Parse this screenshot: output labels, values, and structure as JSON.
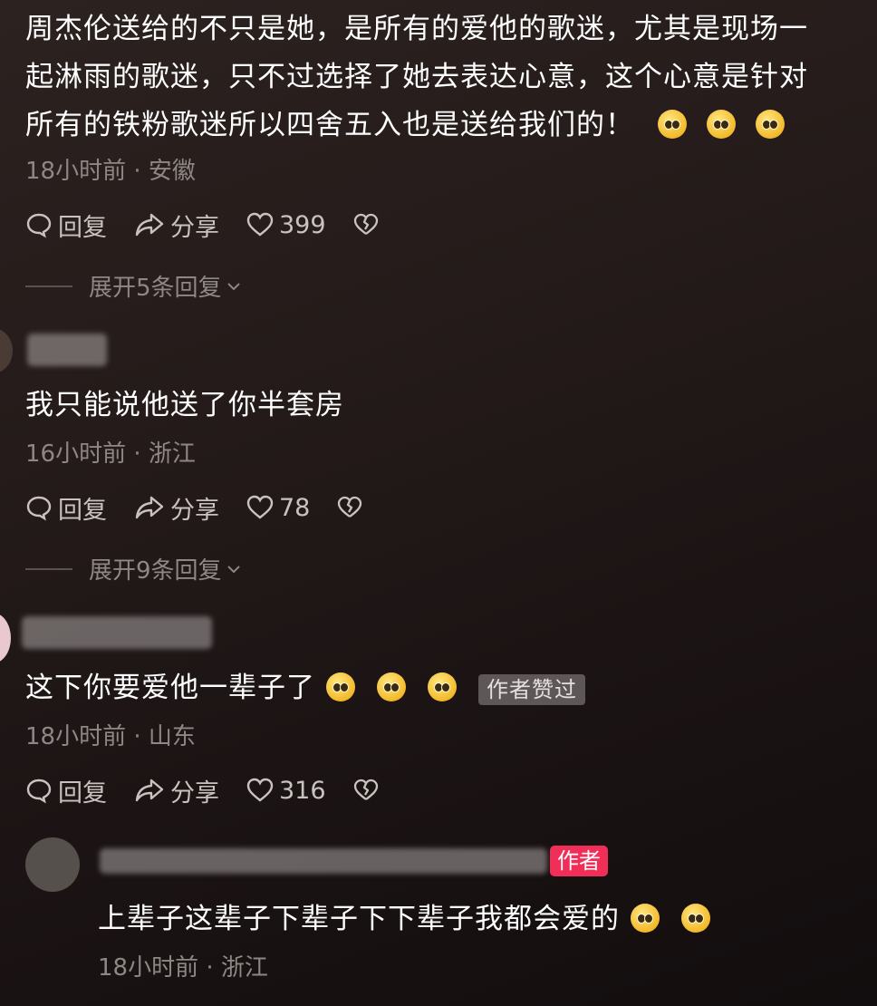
{
  "comments": [
    {
      "text_lines": [
        "周杰伦送给的不只是她，是所有的爱他的歌迷，尤其是现场一",
        "起淋雨的歌迷，只不过选择了她去表达心意，这个心意是针对",
        "所有的铁粉歌迷所以四舍五入也是送给我们的！"
      ],
      "emoji": [
        "pleading-face-emoji",
        "pleading-face-emoji",
        "pleading-face-emoji"
      ],
      "time": "18小时前 · 安徽",
      "reply_label": "回复",
      "share_label": "分享",
      "likes": "399",
      "expand_label": "展开5条回复"
    },
    {
      "text": "我只能说他送了你半套房",
      "time": "16小时前 · 浙江",
      "reply_label": "回复",
      "share_label": "分享",
      "likes": "78",
      "expand_label": "展开9条回复"
    },
    {
      "text": "这下你要爱他一辈子了",
      "emoji": [
        "holding-back-tears-emoji",
        "holding-back-tears-emoji",
        "holding-back-tears-emoji"
      ],
      "badge": "作者赞过",
      "time": "18小时前 · 山东",
      "reply_label": "回复",
      "share_label": "分享",
      "likes": "316"
    }
  ],
  "reply": {
    "author_badge": "作者",
    "text": "上辈子这辈子下辈子下下辈子我都会爱的",
    "emoji": [
      "loudly-crying-face-emoji",
      "loudly-crying-face-emoji"
    ],
    "time": "18小时前 · 浙江"
  },
  "colors": {
    "background": "#241b1a",
    "meta_text": "#8e8784",
    "author_badge": "#f02e58",
    "badge_bg": "#5e5757"
  }
}
